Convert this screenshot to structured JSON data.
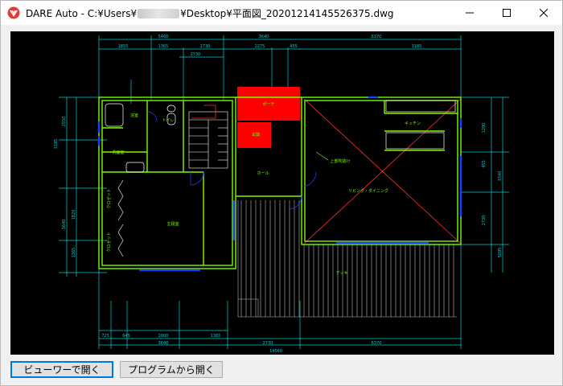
{
  "window": {
    "title_prefix": "DARE Auto - C:¥Users¥",
    "title_suffix": "¥Desktop¥平面図_20201214145526375.dwg"
  },
  "colors": {
    "canvas_bg": "#000000",
    "wall": "#7CFC00",
    "dimension": "#00CED1",
    "highlight": "#FF0000",
    "window_line": "#1E3CFF",
    "primary_border": "#0078d7"
  },
  "drawing": {
    "dims_top": [
      "5460",
      "3640",
      "6370"
    ],
    "dims_top2": [
      "1855",
      "1365",
      "2730",
      "2275",
      "455",
      "3185"
    ],
    "dim_top3": "2730",
    "dims_bottom": [
      "725",
      "645",
      "2000",
      "1365"
    ],
    "dims_bottom2": [
      "3640",
      "2730",
      "6370"
    ],
    "dim_total": "14560",
    "dims_left": [
      "2550",
      "3185",
      "1820",
      "3640",
      "1365"
    ],
    "dims_right": [
      "1290",
      "3340",
      "455",
      "2730",
      "5095"
    ],
    "rooms": [
      {
        "id": "porch",
        "label": "ポーチ"
      },
      {
        "id": "entrance",
        "label": "玄関"
      },
      {
        "id": "kitchen",
        "label": "キッチン"
      },
      {
        "id": "bath",
        "label": "浴室"
      },
      {
        "id": "toilet",
        "label": "トイレ"
      },
      {
        "id": "washroom",
        "label": "洗面室"
      },
      {
        "id": "hall",
        "label": "ホール"
      },
      {
        "id": "living",
        "label": "リビング・ダイニング"
      },
      {
        "id": "bedroom",
        "label": "主寝室"
      },
      {
        "id": "closet1",
        "label": "クロゼット"
      },
      {
        "id": "closet2",
        "label": "クロゼット"
      },
      {
        "id": "deck",
        "label": "デッキ"
      }
    ],
    "annotation": "上部吹抜け"
  },
  "buttons": {
    "viewer": "ビューワーで開く",
    "program": "プログラムから開く"
  }
}
